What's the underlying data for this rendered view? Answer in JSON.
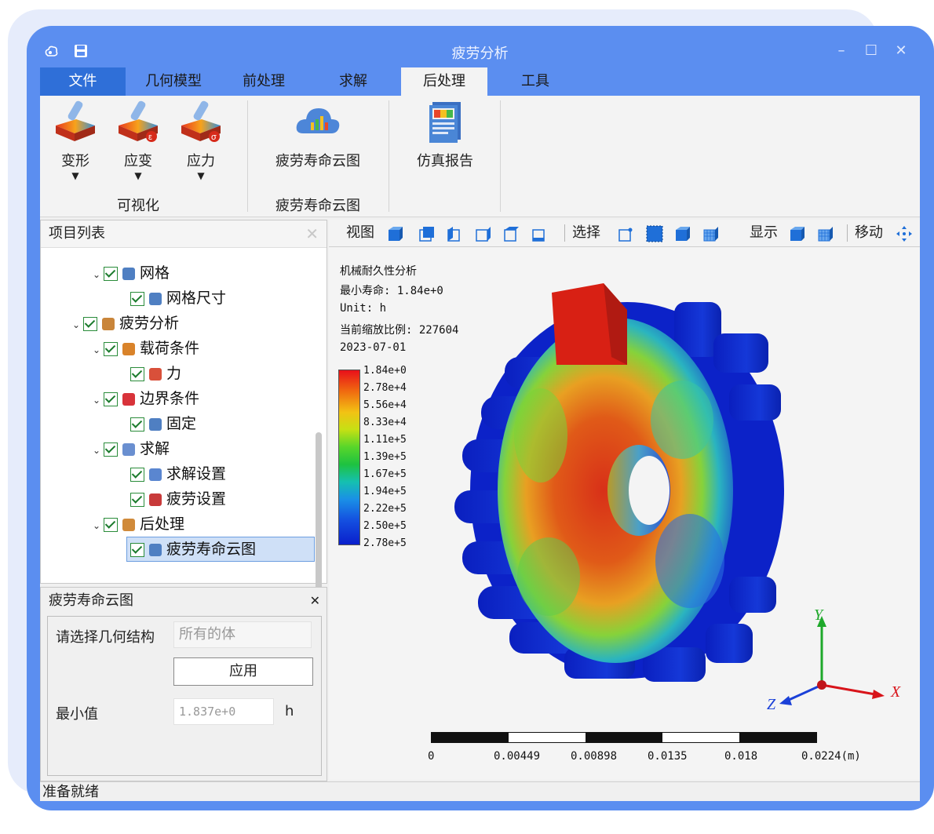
{
  "window": {
    "title": "疲劳分析"
  },
  "menu": [
    {
      "label": "文件"
    },
    {
      "label": "几何模型"
    },
    {
      "label": "前处理"
    },
    {
      "label": "求解"
    },
    {
      "label": "后处理"
    },
    {
      "label": "工具"
    }
  ],
  "ribbon": {
    "deform_label": "变形",
    "strain_label": "应变",
    "stress_label": "应力",
    "group1_caption": "可视化",
    "fatigue_label": "疲劳寿命云图",
    "group2_caption": "疲劳寿命云图",
    "report_label": "仿真报告"
  },
  "project_panel": {
    "title": "项目列表",
    "items": [
      {
        "label": "网格"
      },
      {
        "label": "网格尺寸"
      },
      {
        "label": "疲劳分析"
      },
      {
        "label": "载荷条件"
      },
      {
        "label": "力"
      },
      {
        "label": "边界条件"
      },
      {
        "label": "固定"
      },
      {
        "label": "求解"
      },
      {
        "label": "求解设置"
      },
      {
        "label": "疲劳设置"
      },
      {
        "label": "后处理"
      },
      {
        "label": "疲劳寿命云图"
      }
    ]
  },
  "prop_panel": {
    "title": "疲劳寿命云图",
    "geom_label": "请选择几何结构",
    "geom_value": "所有的体",
    "apply_label": "应用",
    "min_label": "最小值",
    "min_value": "1.837e+0",
    "min_unit": "h"
  },
  "view_toolbar": {
    "view_label": "视图",
    "select_label": "选择",
    "display_label": "显示",
    "move_label": "移动"
  },
  "viewport": {
    "info_title": "机械耐久性分析",
    "info_min_life": "最小寿命: 1.84e+0",
    "info_unit": "Unit: h",
    "info_scale": "当前缩放比例: 227604",
    "info_date": "2023-07-01",
    "legend": [
      "1.84e+0",
      "2.78e+4",
      "5.56e+4",
      "8.33e+4",
      "1.11e+5",
      "1.39e+5",
      "1.67e+5",
      "1.94e+5",
      "2.22e+5",
      "2.50e+5",
      "2.78e+5"
    ],
    "scale_ticks": [
      "0",
      "0.00449",
      "0.00898",
      "0.0135",
      "0.018",
      "0.0224(m)"
    ],
    "axis_x": "X",
    "axis_y": "Y",
    "axis_z": "Z"
  },
  "status": {
    "text": "准备就绪"
  },
  "colors": {
    "accent": "#5b8ef0",
    "file_menu": "#2f6fd8"
  }
}
